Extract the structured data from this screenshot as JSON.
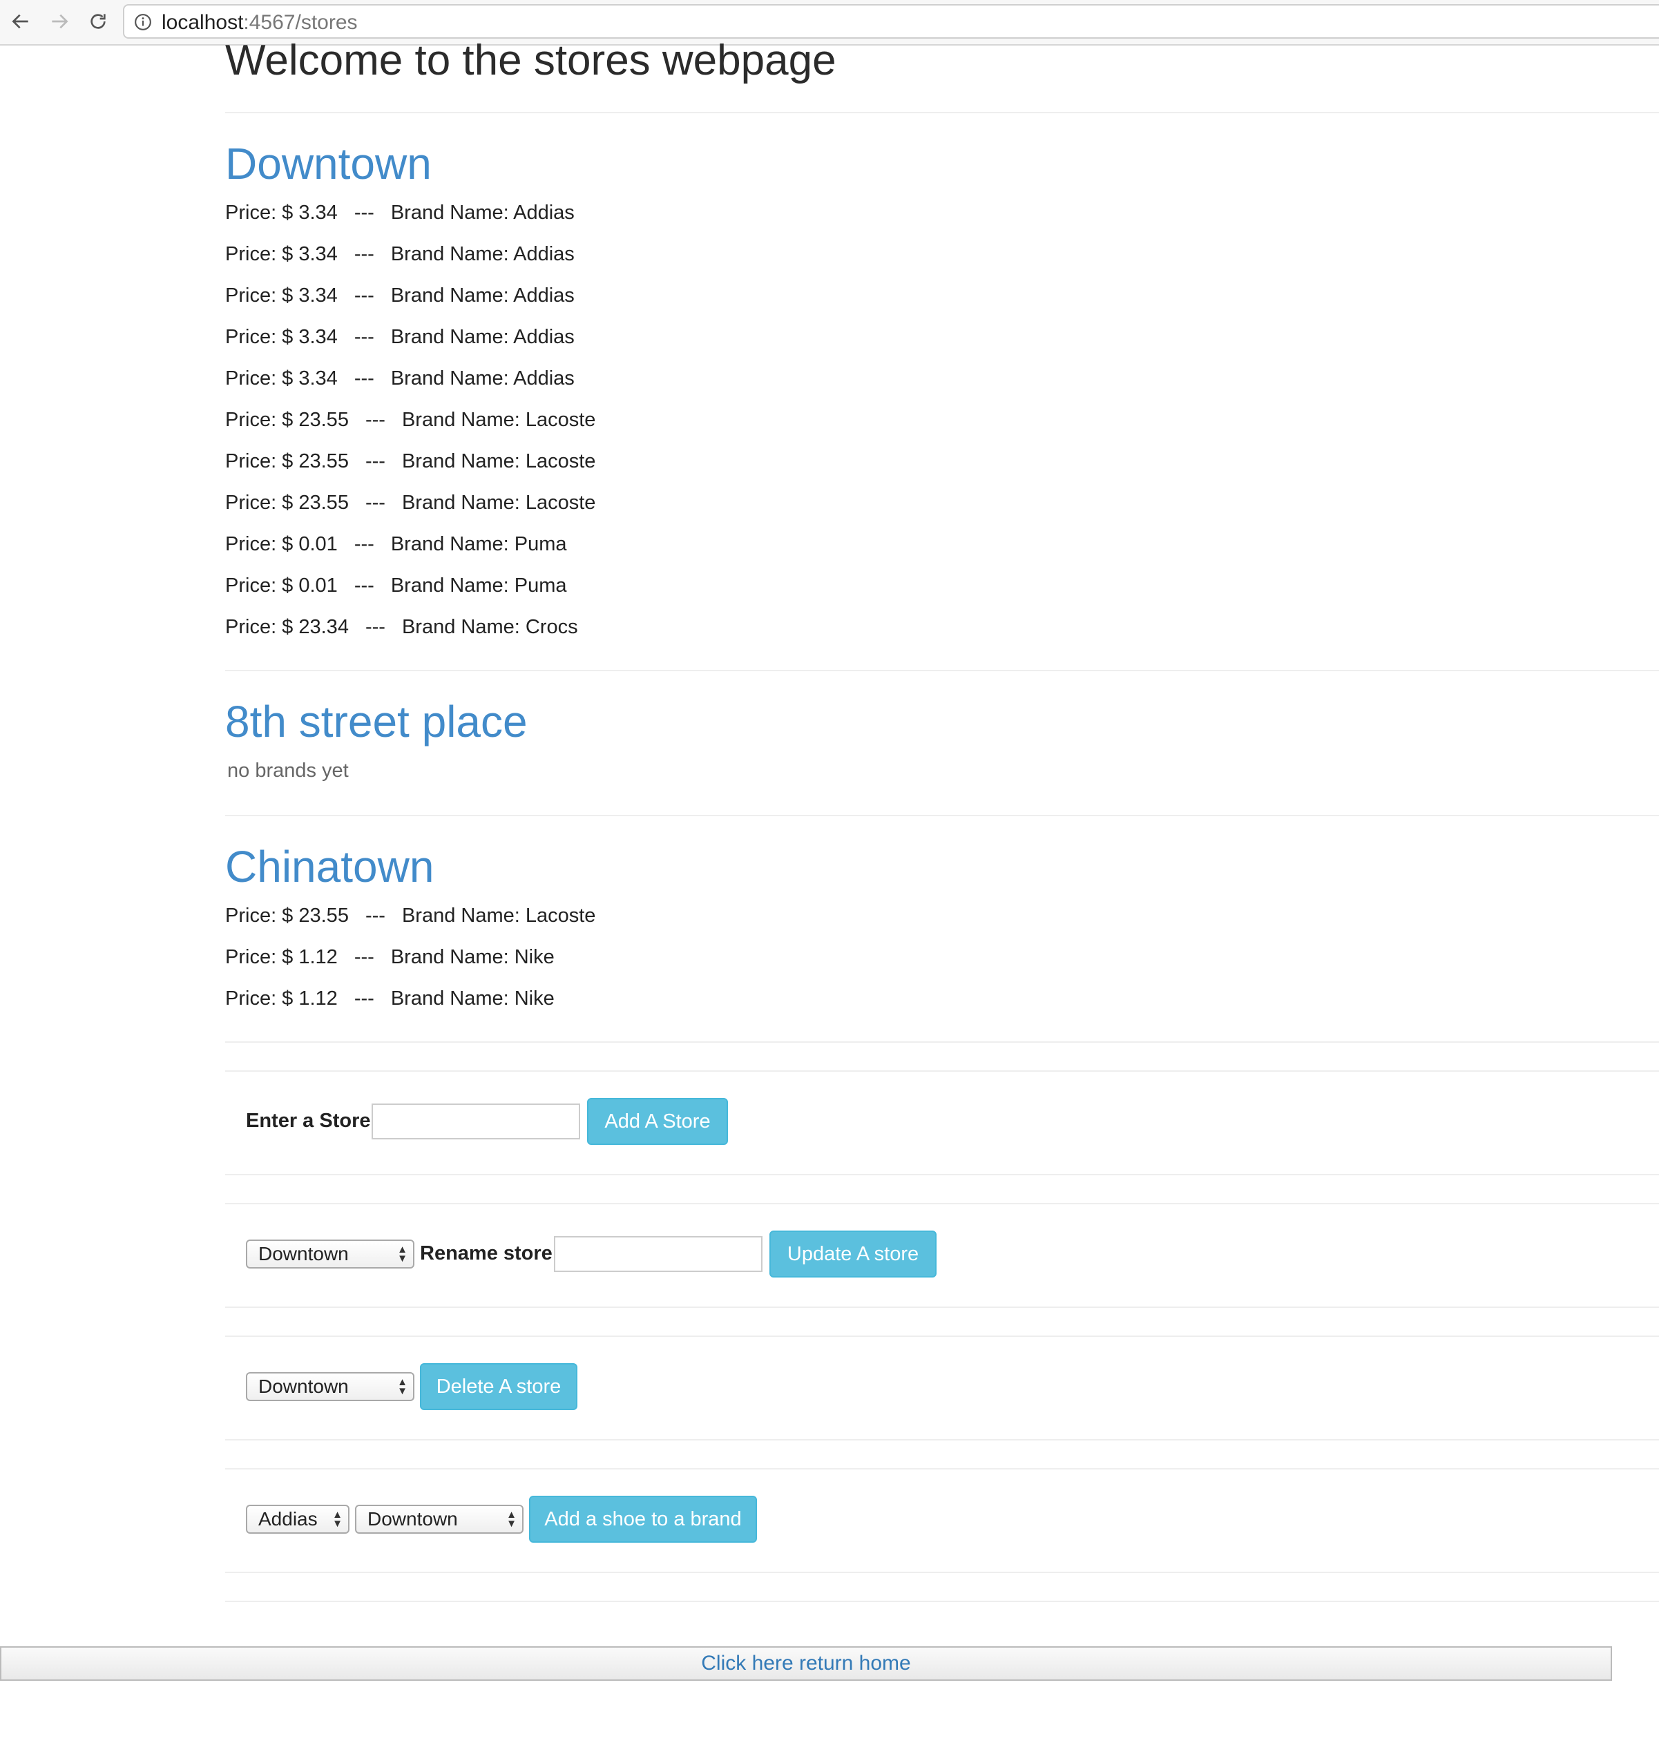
{
  "browser": {
    "url_host": "localhost",
    "url_path": ":4567/stores"
  },
  "page": {
    "title": "Welcome to the stores webpage"
  },
  "stores": [
    {
      "name": "Downtown",
      "brands": [
        {
          "price": "Price: $ 3.34",
          "sep": "---",
          "brand": "Brand Name: Addias"
        },
        {
          "price": "Price: $ 3.34",
          "sep": "---",
          "brand": "Brand Name: Addias"
        },
        {
          "price": "Price: $ 3.34",
          "sep": "---",
          "brand": "Brand Name: Addias"
        },
        {
          "price": "Price: $ 3.34",
          "sep": "---",
          "brand": "Brand Name: Addias"
        },
        {
          "price": "Price: $ 3.34",
          "sep": "---",
          "brand": "Brand Name: Addias"
        },
        {
          "price": "Price: $ 23.55",
          "sep": "---",
          "brand": "Brand Name: Lacoste"
        },
        {
          "price": "Price: $ 23.55",
          "sep": "---",
          "brand": "Brand Name: Lacoste"
        },
        {
          "price": "Price: $ 23.55",
          "sep": "---",
          "brand": "Brand Name: Lacoste"
        },
        {
          "price": "Price: $ 0.01",
          "sep": "---",
          "brand": "Brand Name: Puma"
        },
        {
          "price": "Price: $ 0.01",
          "sep": "---",
          "brand": "Brand Name: Puma"
        },
        {
          "price": "Price: $ 23.34",
          "sep": "---",
          "brand": "Brand Name: Crocs"
        }
      ]
    },
    {
      "name": "8th street place",
      "empty_text": "no brands yet"
    },
    {
      "name": "Chinatown",
      "brands": [
        {
          "price": "Price: $ 23.55",
          "sep": "---",
          "brand": "Brand Name: Lacoste"
        },
        {
          "price": "Price: $ 1.12",
          "sep": "---",
          "brand": "Brand Name: Nike"
        },
        {
          "price": "Price: $ 1.12",
          "sep": "---",
          "brand": "Brand Name: Nike"
        }
      ]
    }
  ],
  "forms": {
    "add_store": {
      "label": "Enter a Store",
      "value": "",
      "button": "Add A Store"
    },
    "update_store": {
      "selected": "Downtown",
      "label": "Rename store",
      "value": "",
      "button": "Update A store"
    },
    "delete_store": {
      "selected": "Downtown",
      "button": "Delete A store"
    },
    "add_shoe": {
      "brand_selected": "Addias",
      "store_selected": "Downtown",
      "button": "Add a shoe to a brand"
    }
  },
  "footer": {
    "link": "Click here return home"
  },
  "colors": {
    "store_heading": "#428bca",
    "button_bg": "#5bc0de",
    "link": "#337ab7"
  },
  "icons": {
    "back": "back-arrow-icon",
    "forward": "forward-arrow-icon",
    "reload": "reload-icon",
    "info": "info-icon",
    "select_arrows": "select-arrows-icon"
  }
}
